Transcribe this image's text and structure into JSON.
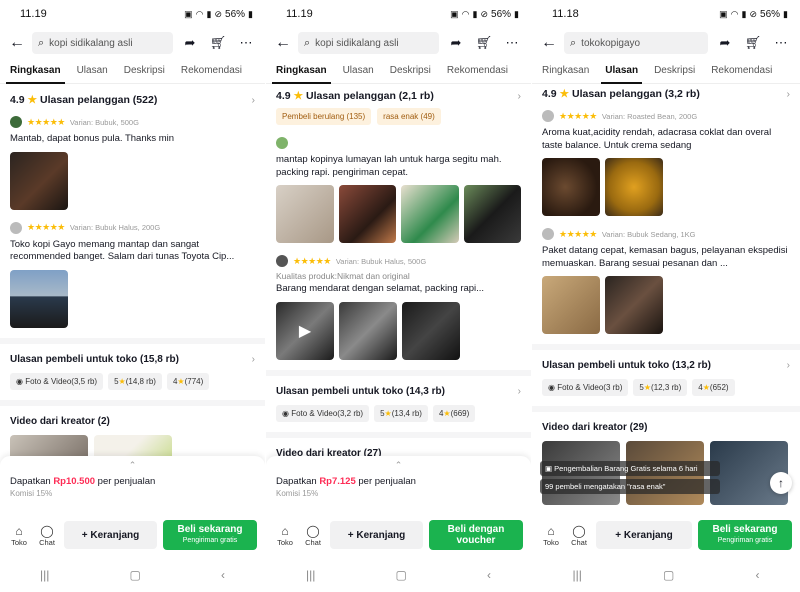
{
  "phones": [
    {
      "time": "11.19",
      "battery": "56%",
      "search_text": "kopi sidikalang asli",
      "tabs": [
        "Ringkasan",
        "Ulasan",
        "Deskripsi",
        "Rekomendasi"
      ],
      "active_tab": 0,
      "rating": "4.9",
      "reviews_title": "Ulasan pelanggan (522)",
      "reviews": [
        {
          "stars": "★★★★★",
          "variant": "Varian: Bubuk, 500G",
          "text": "Mantab, dapat bonus pula. Thanks min"
        },
        {
          "stars": "★★★★★",
          "variant": "Varian: Bubuk Halus, 200G",
          "text": "Toko kopi Gayo memang mantap dan sangat recommended banget. Salam dari tunas Toyota Cip..."
        }
      ],
      "store_title": "Ulasan pembeli untuk toko (15,8 rb)",
      "pills": [
        "Foto & Video(3,5 rb)",
        "5",
        "(14,8 rb)",
        "4",
        "(774)"
      ],
      "video_title": "Video dari kreator (2)",
      "commission_prefix": "Dapatkan ",
      "commission_amount": "Rp10.500",
      "commission_suffix": " per penjualan",
      "commission_rate": "Komisi 15%",
      "toko": "Toko",
      "chat": "Chat",
      "cart": "+ Keranjang",
      "buy": "Beli sekarang",
      "buy_sub": "Pengiriman gratis"
    },
    {
      "time": "11.19",
      "battery": "56%",
      "search_text": "kopi sidikalang asli",
      "tabs": [
        "Ringkasan",
        "Ulasan",
        "Deskripsi",
        "Rekomendasi"
      ],
      "active_tab": 0,
      "rating": "4.9",
      "reviews_title": "Ulasan pelanggan (2,1 rb)",
      "chips": [
        "Pembeli berulang (135)",
        "rasa enak (49)"
      ],
      "reviews": [
        {
          "stars": "",
          "variant": "",
          "text": "mantap kopinya lumayan lah untuk harga segitu mah. packing rapi. pengiriman cepat."
        },
        {
          "stars": "★★★★★",
          "variant": "Varian: Bubuk Halus, 500G",
          "kualitas": "Kualitas produk:Nikmat dan original",
          "text": "Barang mendarat dengan selamat, packing rapi..."
        }
      ],
      "store_title": "Ulasan pembeli untuk toko (14,3 rb)",
      "pills": [
        "Foto & Video(3,2 rb)",
        "5",
        "(13,4 rb)",
        "4",
        "(669)"
      ],
      "video_title": "Video dari kreator (27)",
      "commission_prefix": "Dapatkan ",
      "commission_amount": "Rp7.125",
      "commission_suffix": " per penjualan",
      "commission_rate": "Komisi 15%",
      "toko": "Toko",
      "chat": "Chat",
      "cart": "+ Keranjang",
      "buy": "Beli dengan voucher",
      "buy_sub": ""
    },
    {
      "time": "11.18",
      "battery": "56%",
      "search_text": "tokokopigayo",
      "tabs": [
        "Ringkasan",
        "Ulasan",
        "Deskripsi",
        "Rekomendasi"
      ],
      "active_tab": 1,
      "rating": "4.9",
      "reviews_title": "Ulasan pelanggan (3,2 rb)",
      "reviews": [
        {
          "stars": "★★★★★",
          "variant": "Varian: Roasted Bean, 200G",
          "text": "Aroma  kuat,acidity rendah, adacrasa coklat dan overal taste balance. Untuk crema sedang"
        },
        {
          "stars": "★★★★★",
          "variant": "Varian: Bubuk Sedang, 1KG",
          "text": "Paket datang cepat, kemasan bagus, pelayanan ekspedisi memuaskan. Barang sesuai pesanan dan ..."
        }
      ],
      "store_title": "Ulasan pembeli untuk toko (13,2 rb)",
      "pills": [
        "Foto & Video(3 rb)",
        "5",
        "(12,3 rb)",
        "4",
        "(652)"
      ],
      "video_title": "Video dari kreator (29)",
      "toast1": "Pengembalian Barang Gratis selama 6 hari",
      "toast2": "99 pembeli mengatakan \"rasa enak\"",
      "toko": "Toko",
      "chat": "Chat",
      "cart": "+ Keranjang",
      "buy": "Beli sekarang",
      "buy_sub": "Pengiriman gratis"
    }
  ],
  "icons": {
    "back": "arrow-left-icon",
    "search": "search-icon",
    "share": "share-icon",
    "cart": "cart-icon",
    "more": "more-icon",
    "star": "star-icon",
    "store": "store-icon",
    "chat": "chat-icon",
    "nav_recent": "recent-apps-icon",
    "nav_home": "home-icon",
    "nav_back": "nav-back-icon"
  },
  "colors": {
    "accent_red": "#fe2c55",
    "buy_green": "#1bb34f",
    "star": "#fbbd08"
  }
}
